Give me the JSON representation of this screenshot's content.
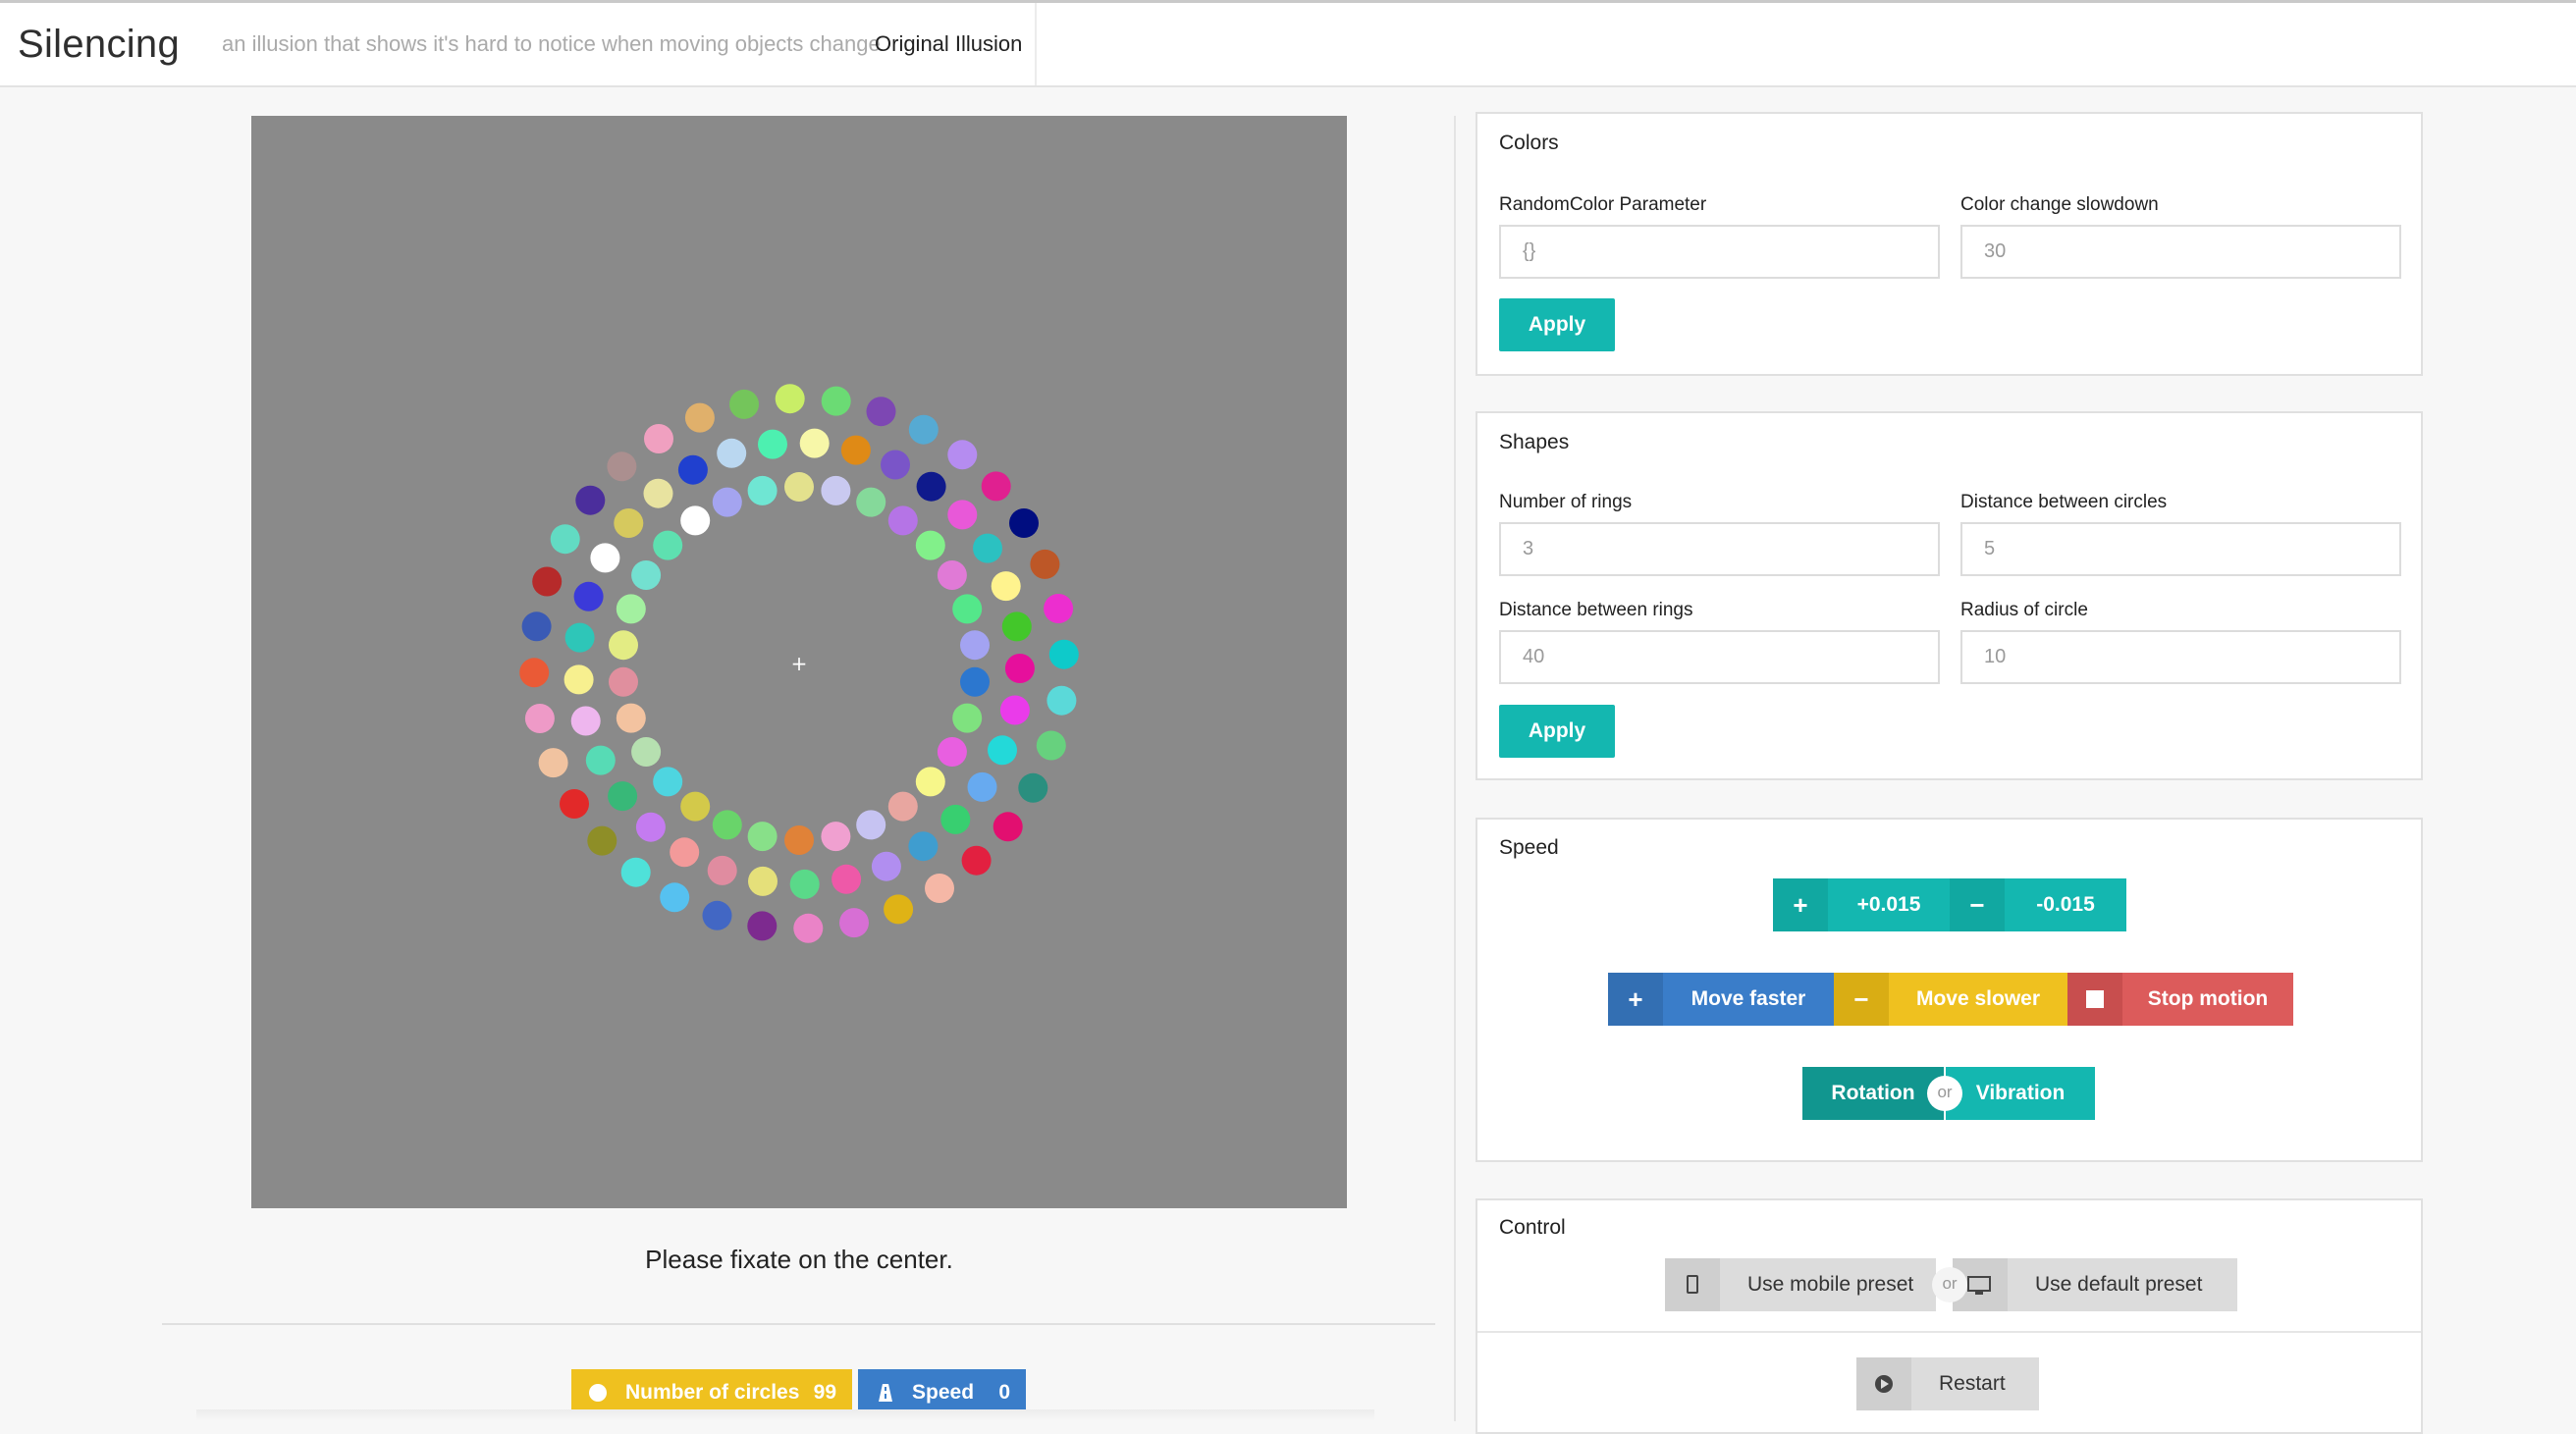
{
  "navbar": {
    "brand": "Silencing",
    "tagline": "an illusion that shows it's hard to notice when moving objects change",
    "link": "Original Illusion"
  },
  "stimulus": {
    "fixation_mark": "+",
    "caption": "Please fixate on the center.",
    "rings": [
      {
        "count": 30,
        "colors": [
          "#e3e18d",
          "#c9c9f0",
          "#85d99a",
          "#b574e6",
          "#82f08a",
          "#e07ad6",
          "#54e78a",
          "#a3a3f2",
          "#2c77cf",
          "#7fe27f",
          "#e85fe0",
          "#f7f78a",
          "#e8a6a0",
          "#c6c3f2",
          "#f0a0d0",
          "#e08238",
          "#88e089",
          "#69d46a",
          "#d3c94a",
          "#4ed5e0",
          "#b6e0b0",
          "#f3c3a0",
          "#e08f9e",
          "#e3ec84",
          "#a3f0a0",
          "#73e0d0",
          "#5ee0b0",
          "#ffffff",
          "#a4a4f0",
          "#6fe6d3"
        ]
      },
      {
        "count": 33,
        "colors": [
          "#f7f7a8",
          "#df8a16",
          "#7a55c8",
          "#0f1a8c",
          "#e858d8",
          "#2bc1c1",
          "#fff38e",
          "#43c72a",
          "#e60f9c",
          "#ea3bea",
          "#23d9d9",
          "#67aaf0",
          "#38cf70",
          "#3f9dcf",
          "#b18ef0",
          "#ee59a8",
          "#5ad989",
          "#e5e07a",
          "#e08ca0",
          "#f39a9a",
          "#c47bf0",
          "#38b878",
          "#57dbb5",
          "#eeb6ee",
          "#f7f08f",
          "#2ec6b8",
          "#3b3ad9",
          "#ffffff",
          "#d6c95e",
          "#e8e3a0",
          "#2040cf",
          "#bad7f0",
          "#4df0b0"
        ]
      },
      {
        "count": 36,
        "colors": [
          "#6bdb74",
          "#7d47b3",
          "#56aad3",
          "#b58cf0",
          "#e02090",
          "#000d80",
          "#bd5727",
          "#ec2ecf",
          "#0ecaca",
          "#5bd9d9",
          "#67d17e",
          "#2a8f7f",
          "#e20f70",
          "#e22040",
          "#f5b7a6",
          "#dfb316",
          "#d76fd4",
          "#ea83c7",
          "#7d2a8f",
          "#4267c4",
          "#56c1f0",
          "#4fe1d9",
          "#8e8e27",
          "#e22929",
          "#f1c3a0",
          "#ee9ac7",
          "#ea5a36",
          "#3a5ab5",
          "#b62a2a",
          "#62dbc3",
          "#4b2e9c",
          "#ab8f8f",
          "#f0a0c0",
          "#e0b06b",
          "#74c55b",
          "#c9ee67"
        ]
      }
    ]
  },
  "stats": {
    "circles_label": "Number of circles",
    "circles_value": "99",
    "speed_label": "Speed",
    "speed_value": "0"
  },
  "colors_panel": {
    "title": "Colors",
    "random_label": "RandomColor Parameter",
    "random_value": "{}",
    "slowdown_label": "Color change slowdown",
    "slowdown_value": "30",
    "apply": "Apply"
  },
  "shapes_panel": {
    "title": "Shapes",
    "rings_label": "Number of rings",
    "rings_value": "3",
    "dist_circles_label": "Distance between circles",
    "dist_circles_value": "5",
    "dist_rings_label": "Distance between rings",
    "dist_rings_value": "40",
    "radius_label": "Radius of circle",
    "radius_value": "10",
    "apply": "Apply"
  },
  "speed_panel": {
    "title": "Speed",
    "plus_step": "+0.015",
    "minus_step": "-0.015",
    "faster": "Move faster",
    "slower": "Move slower",
    "stop": "Stop motion",
    "rotation": "Rotation",
    "or": "or",
    "vibration": "Vibration"
  },
  "control_panel": {
    "title": "Control",
    "mobile": "Use mobile preset",
    "or": "or",
    "default": "Use default preset",
    "restart": "Restart"
  },
  "colors": {
    "teal": "#14b7b0",
    "blue": "#3a7dc9",
    "yellow": "#efc11f",
    "red": "#dc5b5b",
    "canvas": "#8a8a8a"
  }
}
